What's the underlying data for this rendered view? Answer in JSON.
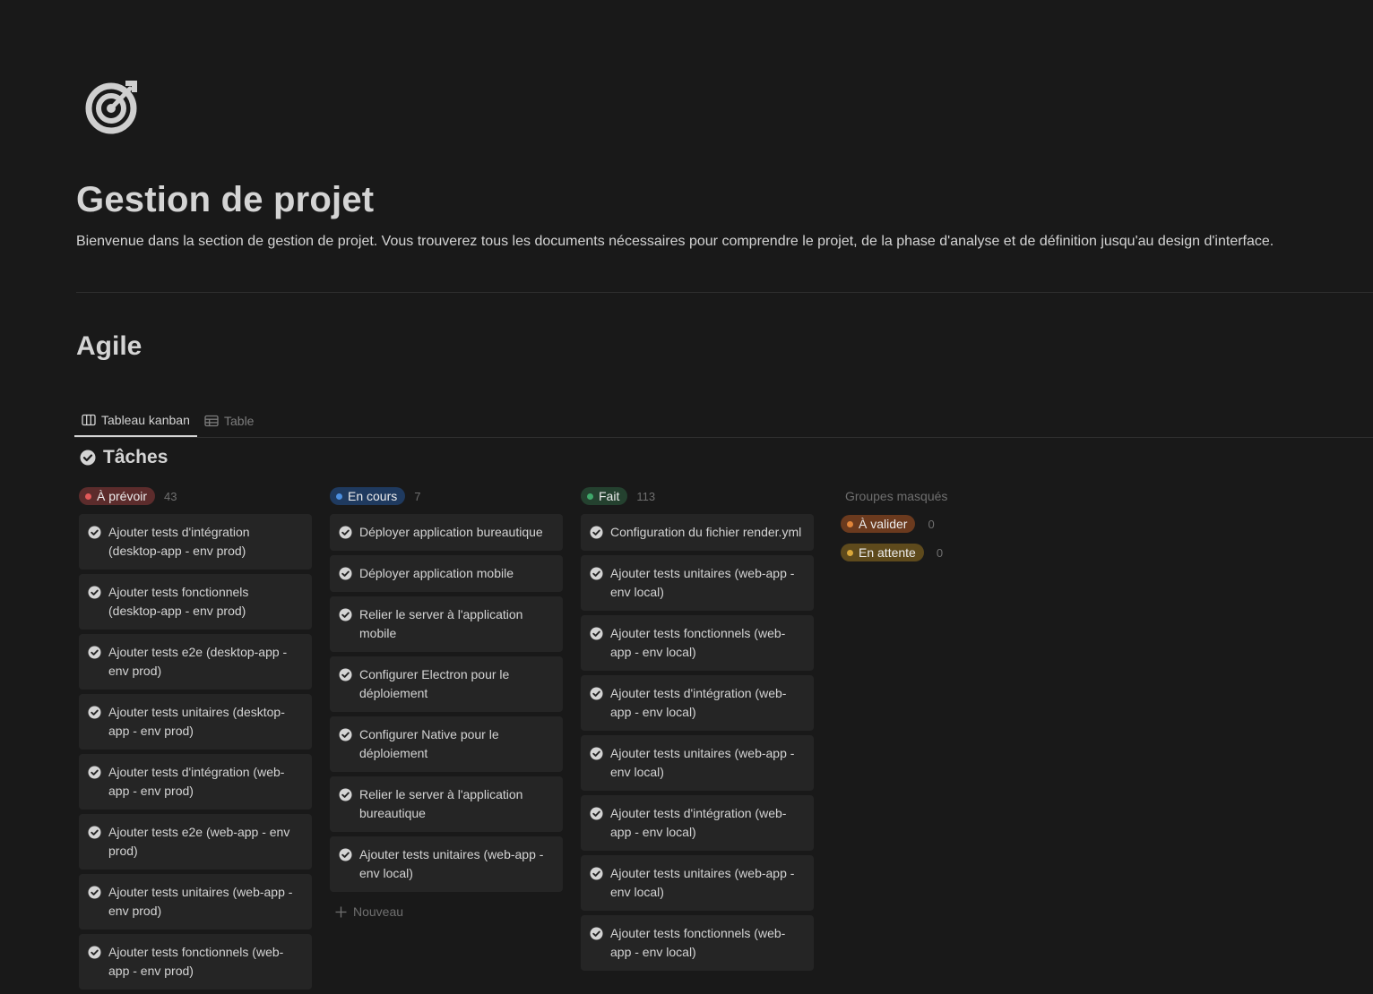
{
  "page": {
    "icon": "target-icon",
    "title": "Gestion de projet",
    "description": "Bienvenue dans la section de gestion de projet. Vous trouverez tous les documents nécessaires pour comprendre le projet, de la phase d'analyse et de définition jusqu'au design d'interface."
  },
  "section": {
    "heading": "Agile"
  },
  "views": [
    {
      "label": "Tableau kanban",
      "icon": "board-icon",
      "active": true
    },
    {
      "label": "Table",
      "icon": "table-icon",
      "active": false
    }
  ],
  "database": {
    "title": "Tâches",
    "icon": "check-circle-icon"
  },
  "columns": [
    {
      "status": "À prévoir",
      "count": "43",
      "colors": {
        "pill": "#5c2c2c",
        "dot": "#e25959"
      },
      "cards": [
        "Ajouter tests d'intégration (desktop-app - env prod)",
        "Ajouter tests fonctionnels (desktop-app - env prod)",
        "Ajouter tests e2e (desktop-app - env prod)",
        "Ajouter tests unitaires (desktop-app - env prod)",
        "Ajouter tests d'intégration (web-app - env prod)",
        "Ajouter tests e2e (web-app - env prod)",
        "Ajouter tests unitaires (web-app - env prod)",
        "Ajouter tests fonctionnels (web-app - env prod)"
      ]
    },
    {
      "status": "En cours",
      "count": "7",
      "colors": {
        "pill": "#1f3a5f",
        "dot": "#4c8fe0"
      },
      "cards": [
        "Déployer application bureautique",
        "Déployer application mobile",
        "Relier le server à l'application mobile",
        "Configurer Electron pour le déploiement",
        "Configurer Native pour le déploiement",
        "Relier le server à l'application bureautique",
        "Ajouter tests unitaires (web-app - env local)"
      ],
      "new_label": "Nouveau"
    },
    {
      "status": "Fait",
      "count": "113",
      "colors": {
        "pill": "#24412f",
        "dot": "#3fa86a"
      },
      "cards": [
        "Configuration du fichier render.yml",
        "Ajouter tests unitaires (web-app - env local)",
        "Ajouter tests fonctionnels (web-app - env local)",
        "Ajouter tests d'intégration (web-app - env local)",
        "Ajouter tests unitaires (web-app - env local)",
        "Ajouter tests d'intégration (web-app - env local)",
        "Ajouter tests unitaires (web-app - env local)",
        "Ajouter tests fonctionnels (web-app - env local)"
      ]
    }
  ],
  "hidden_groups": {
    "title": "Groupes masqués",
    "groups": [
      {
        "status": "À valider",
        "count": "0",
        "colors": {
          "pill": "#6b3a1e",
          "dot": "#e0843a"
        }
      },
      {
        "status": "En attente",
        "count": "0",
        "colors": {
          "pill": "#5e4a1c",
          "dot": "#d9a73a"
        }
      }
    ]
  }
}
